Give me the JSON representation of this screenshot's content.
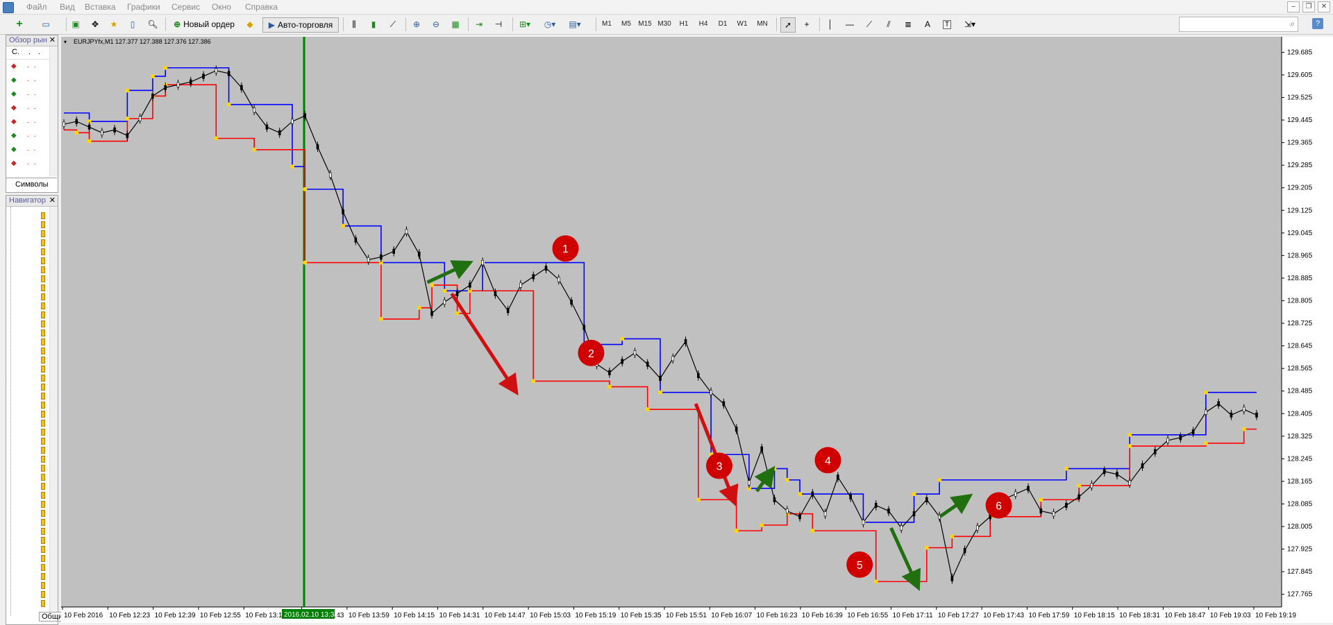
{
  "menu": {
    "items": [
      "Файл",
      "Вид",
      "Вставка",
      "Графики",
      "Сервис",
      "Окно",
      "Справка"
    ]
  },
  "toolbar": {
    "new_order": "Новый ордер",
    "autotrading": "Авто-торговля",
    "timeframes": [
      "M1",
      "M5",
      "M15",
      "M30",
      "H1",
      "H4",
      "D1",
      "W1",
      "MN"
    ],
    "icons": [
      "new-chart-icon",
      "profiles-icon",
      "market-watch-icon",
      "navigator-icon",
      "favorites-icon",
      "data-window-icon",
      "strategy-tester-icon",
      "expert-icon",
      "bar-chart-icon",
      "candle-chart-icon",
      "line-chart-icon",
      "zoom-in-icon",
      "zoom-out-icon",
      "tile-icon",
      "autoscroll-icon",
      "chart-shift-icon",
      "indicators-icon",
      "period-icon",
      "templates-icon",
      "cursor-icon",
      "crosshair-icon",
      "vertical-line-icon",
      "horizontal-line-icon",
      "trendline-icon",
      "channel-icon",
      "fibo-icon",
      "text-icon",
      "text-label-icon",
      "arrows-icon"
    ],
    "search_placeholder": ""
  },
  "market_watch": {
    "title": "Обзор рын",
    "columns": [
      "С.",
      ".",
      "."
    ],
    "tab_label": "Символы",
    "rows": [
      {
        "dir": "down"
      },
      {
        "dir": "up"
      },
      {
        "dir": "up"
      },
      {
        "dir": "down"
      },
      {
        "dir": "down"
      },
      {
        "dir": "up"
      },
      {
        "dir": "up"
      },
      {
        "dir": "down"
      }
    ]
  },
  "navigator": {
    "title": "Навигатор",
    "tab_label": "Общие"
  },
  "chart": {
    "header": "EURJPYfx,M1  127.377 127.388 127.376 127.386",
    "marker_label": "2016.02.10 13:34",
    "colors": {
      "background": "#c0c0c0",
      "upper_channel": "#0000ff",
      "lower_channel": "#ff0000",
      "fractal_points": "#ffd700",
      "vline": "#008000",
      "annotation_circle": "#d00000",
      "arrow_red": "#d01010",
      "arrow_green": "#207010"
    }
  },
  "chart_data": {
    "type": "line",
    "title": "EURJPYfx,M1",
    "ylim": [
      127.72,
      129.74
    ],
    "y_ticks": [
      "129.685",
      "129.605",
      "129.525",
      "129.445",
      "129.365",
      "129.285",
      "129.205",
      "129.125",
      "129.045",
      "128.965",
      "128.885",
      "128.805",
      "128.725",
      "128.645",
      "128.565",
      "128.485",
      "128.405",
      "128.325",
      "128.245",
      "128.165",
      "128.085",
      "128.005",
      "127.925",
      "127.845",
      "127.765"
    ],
    "x_ticks": [
      "10 Feb 2016",
      "10 Feb 12:23",
      "10 Feb 12:39",
      "10 Feb 12:55",
      "10 Feb 13:11",
      "10 Feb 13:43",
      "10 Feb 13:59",
      "10 Feb 14:15",
      "10 Feb 14:31",
      "10 Feb 14:47",
      "10 Feb 15:03",
      "10 Feb 15:19",
      "10 Feb 15:35",
      "10 Feb 15:51",
      "10 Feb 16:07",
      "10 Feb 16:23",
      "10 Feb 16:39",
      "10 Feb 16:55",
      "10 Feb 17:11",
      "10 Feb 17:27",
      "10 Feb 17:43",
      "10 Feb 17:59",
      "10 Feb 18:15",
      "10 Feb 18:31",
      "10 Feb 18:47",
      "10 Feb 19:03",
      "10 Feb 19:19"
    ],
    "series": [
      {
        "name": "",
        "values": [
          129.43,
          129.44,
          129.42,
          129.4,
          129.41,
          129.39,
          129.45,
          129.53,
          129.56,
          129.57,
          129.58,
          129.6,
          129.62,
          129.61,
          129.56,
          129.48,
          129.42,
          129.4,
          129.44,
          129.46,
          129.35,
          129.25,
          129.12,
          129.02,
          128.95,
          128.96,
          128.98,
          129.05,
          128.97,
          128.76,
          128.8,
          128.83,
          128.86,
          128.94,
          128.83,
          128.77,
          128.86,
          128.89,
          128.92,
          128.88,
          128.8,
          128.71,
          128.58,
          128.55,
          128.59,
          128.62,
          128.58,
          128.53,
          128.6,
          128.66,
          128.54,
          128.48,
          128.44,
          128.35,
          128.16,
          128.28,
          128.1,
          128.06,
          128.04,
          128.12,
          128.05,
          128.18,
          128.11,
          128.02,
          128.08,
          128.06,
          128.0,
          128.05,
          128.1,
          128.04,
          127.82,
          127.92,
          128.0,
          128.04,
          128.1,
          128.12,
          128.14,
          128.06,
          128.05,
          128.08,
          128.11,
          128.15,
          128.2,
          128.19,
          128.16,
          128.22,
          128.27,
          128.31,
          128.32,
          128.34,
          128.41,
          128.44,
          128.4,
          128.42,
          128.4
        ]
      },
      {
        "name": "",
        "values": [
          129.47,
          129.47,
          129.44,
          129.44,
          129.44,
          129.55,
          129.55,
          129.6,
          129.63,
          129.63,
          129.63,
          129.63,
          129.63,
          129.5,
          129.5,
          129.5,
          129.5,
          129.5,
          129.28,
          129.2,
          129.2,
          129.2,
          129.07,
          129.07,
          129.07,
          128.94,
          128.94,
          128.94,
          128.94,
          128.94,
          128.84,
          128.84,
          128.84,
          128.94,
          128.94,
          128.94,
          128.94,
          128.94,
          128.94,
          128.94,
          128.94,
          128.65,
          128.65,
          128.65,
          128.67,
          128.67,
          128.67,
          128.48,
          128.48,
          128.48,
          128.48,
          128.26,
          128.26,
          128.26,
          128.14,
          128.14,
          128.21,
          128.17,
          128.12,
          128.12,
          128.12,
          128.12,
          128.12,
          128.02,
          128.02,
          128.02,
          128.02,
          128.12,
          128.12,
          128.17,
          128.17,
          128.17,
          128.17,
          128.17,
          128.17,
          128.17,
          128.17,
          128.17,
          128.17,
          128.21,
          128.21,
          128.21,
          128.21,
          128.21,
          128.33,
          128.33,
          128.33,
          128.33,
          128.33,
          128.33,
          128.48,
          128.48,
          128.48,
          128.48,
          128.48
        ]
      },
      {
        "name": "",
        "values": [
          129.41,
          129.4,
          129.37,
          129.37,
          129.37,
          129.45,
          129.45,
          129.53,
          129.57,
          129.57,
          129.57,
          129.57,
          129.38,
          129.38,
          129.38,
          129.34,
          129.34,
          129.34,
          129.34,
          128.94,
          128.94,
          128.94,
          128.94,
          128.94,
          128.94,
          128.74,
          128.74,
          128.74,
          128.78,
          128.86,
          128.86,
          128.76,
          128.84,
          128.84,
          128.84,
          128.84,
          128.84,
          128.52,
          128.52,
          128.52,
          128.52,
          128.52,
          128.52,
          128.5,
          128.5,
          128.5,
          128.42,
          128.42,
          128.42,
          128.42,
          128.1,
          128.1,
          128.1,
          127.99,
          127.99,
          128.01,
          128.01,
          128.05,
          128.05,
          127.99,
          127.99,
          127.99,
          127.99,
          127.99,
          127.81,
          127.81,
          127.81,
          127.81,
          127.93,
          127.93,
          127.97,
          127.97,
          127.97,
          128.04,
          128.04,
          128.04,
          128.04,
          128.1,
          128.1,
          128.1,
          128.15,
          128.15,
          128.15,
          128.15,
          128.29,
          128.29,
          128.29,
          128.29,
          128.29,
          128.29,
          128.3,
          128.3,
          128.3,
          128.35,
          128.35
        ]
      }
    ],
    "annotations": [
      "1",
      "2",
      "3",
      "4",
      "5",
      "6"
    ],
    "annotation_values": [
      128.99,
      128.62,
      128.22,
      128.24,
      127.87,
      128.08
    ],
    "arrows": [
      {
        "color": "green",
        "from": [
          0.3,
          128.87
        ],
        "to": [
          0.33,
          128.93
        ]
      },
      {
        "color": "red",
        "from": [
          0.32,
          128.83
        ],
        "to": [
          0.37,
          128.5
        ]
      },
      {
        "color": "red",
        "from": [
          0.52,
          128.44
        ],
        "to": [
          0.55,
          128.11
        ]
      },
      {
        "color": "green",
        "from": [
          0.57,
          128.13
        ],
        "to": [
          0.58,
          128.19
        ]
      },
      {
        "color": "green",
        "from": [
          0.68,
          128.0
        ],
        "to": [
          0.7,
          127.81
        ]
      },
      {
        "color": "green",
        "from": [
          0.72,
          128.04
        ],
        "to": [
          0.74,
          128.1
        ]
      }
    ]
  }
}
